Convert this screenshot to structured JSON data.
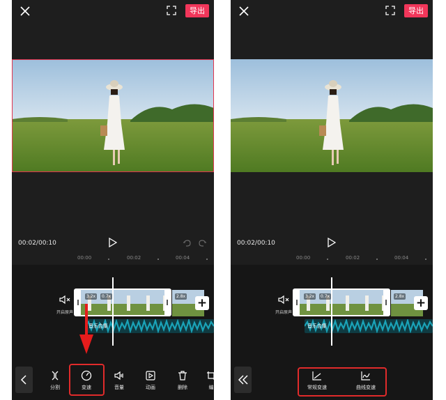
{
  "export_label": "导出",
  "time_display": "00:02/00:10",
  "ruler_ticks": [
    "00:00",
    "00:02",
    "00:04"
  ],
  "mute_label": "开启原声",
  "speed_badges": [
    "3.2x",
    "0.7x",
    "2.8x"
  ],
  "music_label": "音乐合集",
  "left_toolbar": [
    {
      "label": "分割",
      "icon": "split-icon"
    },
    {
      "label": "变速",
      "icon": "speed-icon"
    },
    {
      "label": "音量",
      "icon": "volume-icon"
    },
    {
      "label": "动画",
      "icon": "animation-icon"
    },
    {
      "label": "删除",
      "icon": "delete-icon"
    },
    {
      "label": "编",
      "icon": "edit-icon"
    }
  ],
  "right_toolbar": [
    {
      "label": "常规变速",
      "icon": "normal-speed-icon"
    },
    {
      "label": "曲线变速",
      "icon": "curve-speed-icon"
    }
  ],
  "colors": {
    "accent": "#f1365a",
    "highlight": "#e12b2b",
    "audio_wave": "#1aa3b8",
    "background": "#1e1e1e"
  }
}
